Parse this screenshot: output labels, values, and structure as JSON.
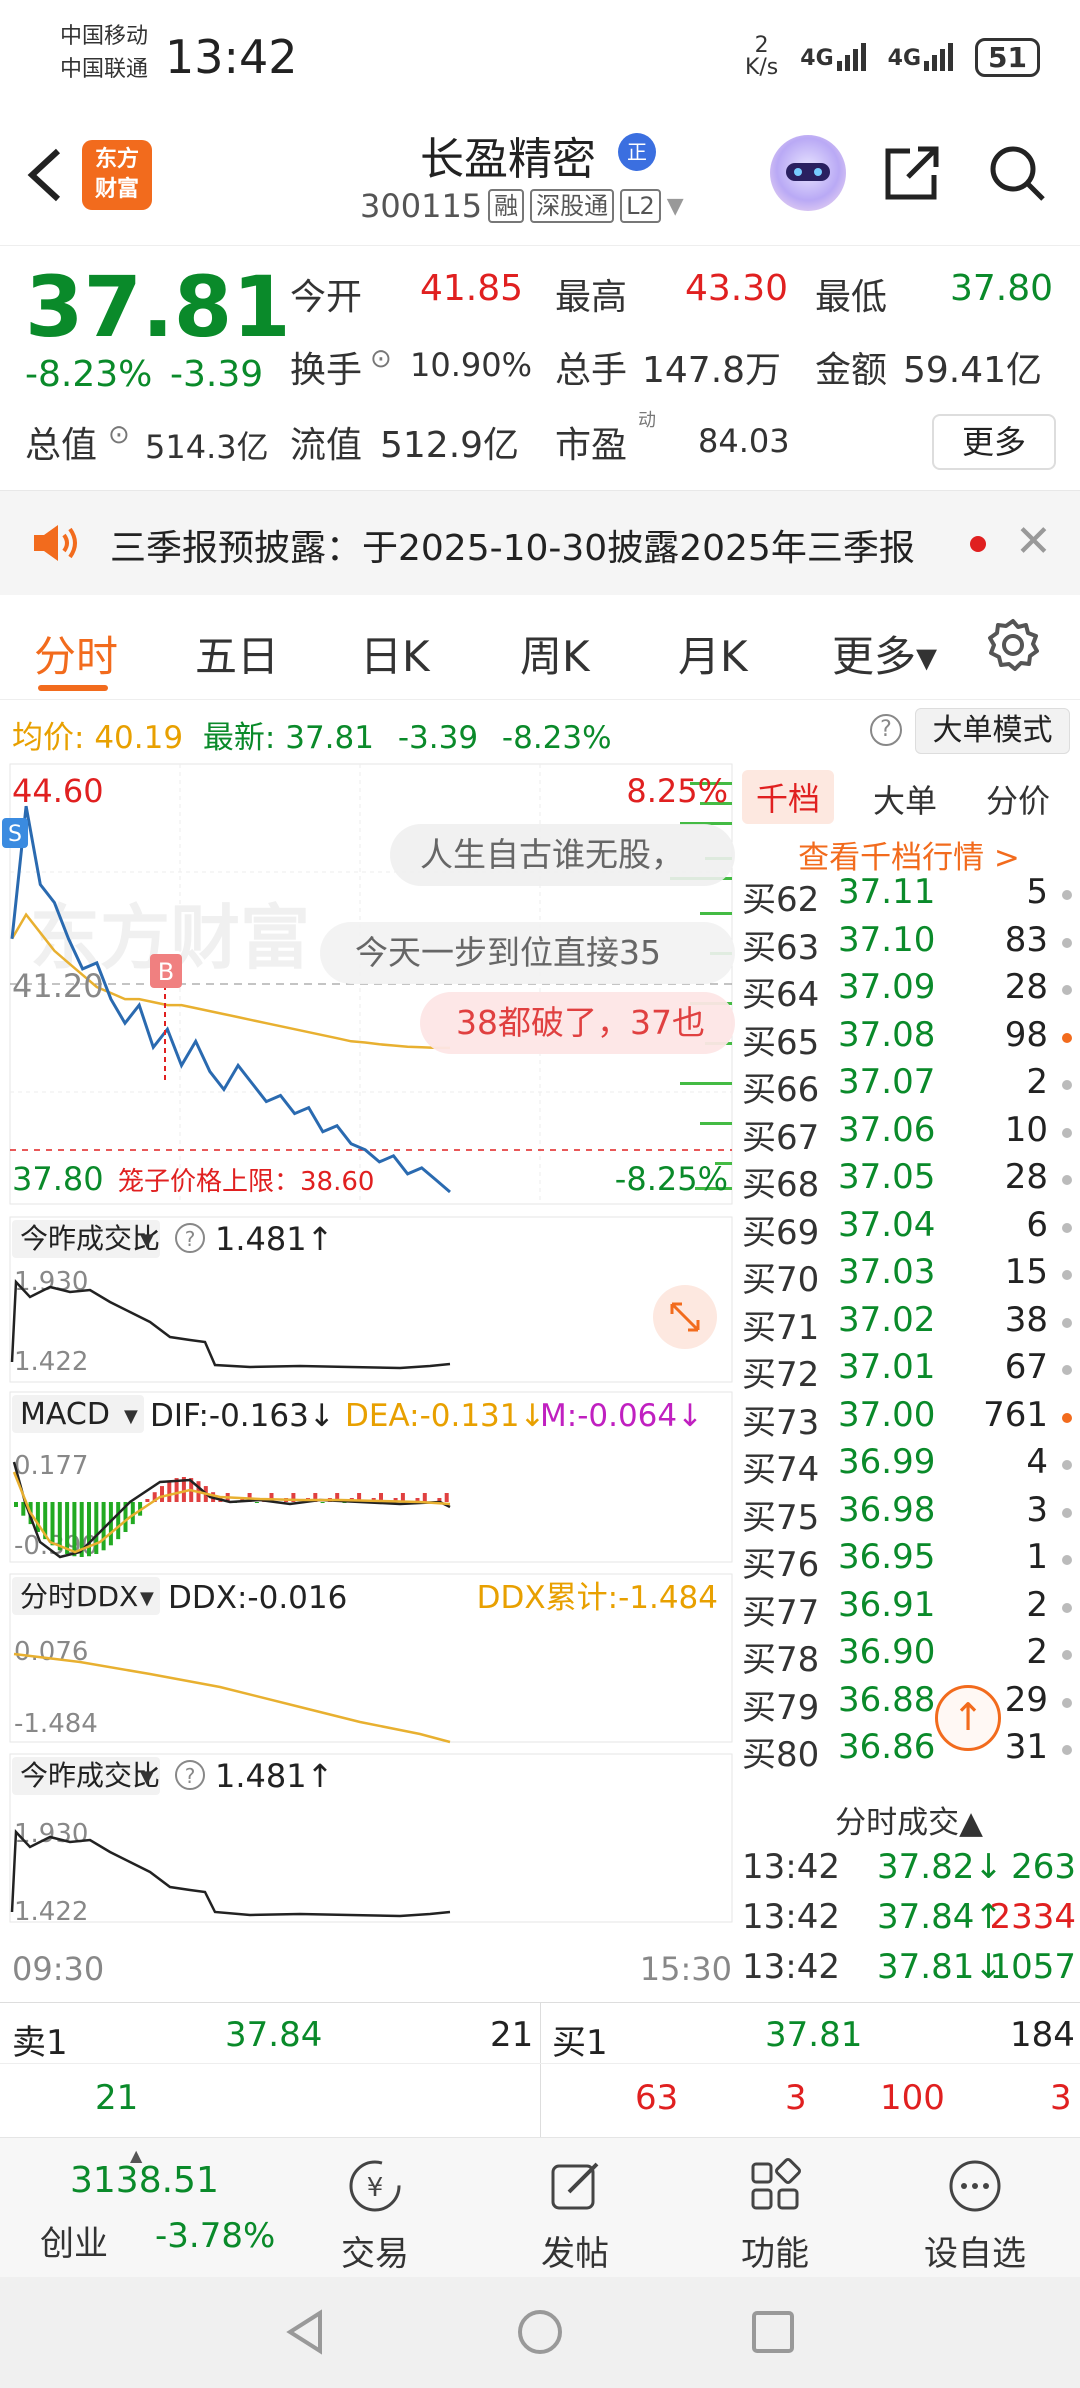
{
  "status_bar": {
    "carrier1": "中国移动",
    "carrier2": "中国联通",
    "time": "13:42",
    "net_speed": "2",
    "net_unit": "K/s",
    "signal1": "4G",
    "signal2": "4G",
    "battery": "51"
  },
  "header": {
    "logo_line1": "东方",
    "logo_line2": "财富",
    "stock_name": "长盈精密",
    "zheng_badge": "正",
    "stock_code": "300115",
    "tag1": "融",
    "tag2": "深股通",
    "tag3": "L2"
  },
  "quote": {
    "price": "37.81",
    "change_pct": "-8.23%",
    "change_amt": "-3.39",
    "open_label": "今开",
    "open": "41.85",
    "high_label": "最高",
    "high": "43.30",
    "low_label": "最低",
    "low": "37.80",
    "turnover_label": "换手",
    "turnover": "10.90%",
    "volume_label": "总手",
    "volume": "147.8万",
    "amount_label": "金额",
    "amount": "59.41亿",
    "mktcap_label": "总值",
    "mktcap": "514.3亿",
    "float_label": "流值",
    "float": "512.9亿",
    "pe_label": "市盈",
    "pe_sup": "动",
    "pe": "84.03",
    "more": "更多"
  },
  "notice": {
    "text": "三季报预披露：于2025-10-30披露2025年三季报"
  },
  "tabs": [
    "分时",
    "五日",
    "日K",
    "周K",
    "月K",
    "更多▾"
  ],
  "info_row": {
    "avg_label": "均价:",
    "avg": "40.19",
    "latest_label": "最新:",
    "latest": "37.81",
    "latest_chg": "-3.39",
    "latest_pct": "-8.23%",
    "help": "?",
    "mode": "大单模式"
  },
  "chart": {
    "price_high": "44.60",
    "price_mid": "41.20",
    "price_low": "37.80",
    "pct_high": "8.25%",
    "pct_low": "-8.25%",
    "watermark": "东方财富",
    "limit_label": "笼子价格上限：38.60",
    "marker_s": "S",
    "marker_b": "B",
    "danmaku1": "人生自古谁无股，",
    "danmaku2": "今天一步到位直接35",
    "danmaku3": "38都破了，37也",
    "vol_ratio_label": "今昨成交比",
    "vol_ratio": "1.481↑",
    "vol_top": "1.930",
    "vol_bottom": "1.422",
    "macd_label": "MACD",
    "dif": "DIF:-0.163↓",
    "dea": "DEA:-0.131↓",
    "m": "M:-0.064↓",
    "macd_top": "0.177",
    "macd_bottom": "-0.390",
    "ddx_label": "分时DDX",
    "ddx": "DDX:-0.016",
    "ddx_cum": "DDX累计:-1.484",
    "ddx_top": "0.076",
    "ddx_bottom": "-1.484",
    "vol_ratio2_label": "今昨成交比",
    "vol_ratio2": "1.481↑",
    "vol2_top": "1.930",
    "vol2_bottom": "1.422",
    "time_start": "09:30",
    "time_end": "15:30"
  },
  "chart_data": {
    "type": "line",
    "series": [
      {
        "name": "price",
        "values": [
          42.0,
          44.2,
          42.9,
          42.6,
          42.0,
          41.5,
          41.6,
          41.0,
          40.6,
          40.9,
          40.2,
          40.5,
          39.9,
          40.3,
          39.8,
          39.5,
          39.9,
          39.6,
          39.3,
          39.4,
          39.1,
          39.2,
          38.8,
          38.9,
          38.6,
          38.5,
          38.3,
          38.4,
          38.1,
          38.2,
          38.0,
          37.8
        ]
      },
      {
        "name": "avg",
        "values": [
          42.0,
          42.4,
          42.1,
          41.8,
          41.6,
          41.4,
          41.2,
          41.1,
          41.0,
          41.0,
          40.95,
          40.9,
          40.9,
          40.85,
          40.8,
          40.75,
          40.7,
          40.65,
          40.6,
          40.55,
          40.5,
          40.45,
          40.4,
          40.35,
          40.3,
          40.28,
          40.25,
          40.23,
          40.21,
          40.2,
          40.19,
          40.19
        ]
      }
    ],
    "ylim": [
      37.8,
      44.6
    ]
  },
  "orderbook": {
    "tabs": [
      "千档",
      "大单",
      "分价"
    ],
    "link": "查看千档行情 >",
    "rows": [
      {
        "label": "买62",
        "price": "37.11",
        "vol": "5",
        "hl": false
      },
      {
        "label": "买63",
        "price": "37.10",
        "vol": "83",
        "hl": false
      },
      {
        "label": "买64",
        "price": "37.09",
        "vol": "28",
        "hl": false
      },
      {
        "label": "买65",
        "price": "37.08",
        "vol": "98",
        "hl": true
      },
      {
        "label": "买66",
        "price": "37.07",
        "vol": "2",
        "hl": false
      },
      {
        "label": "买67",
        "price": "37.06",
        "vol": "10",
        "hl": false
      },
      {
        "label": "买68",
        "price": "37.05",
        "vol": "28",
        "hl": false
      },
      {
        "label": "买69",
        "price": "37.04",
        "vol": "6",
        "hl": false
      },
      {
        "label": "买70",
        "price": "37.03",
        "vol": "15",
        "hl": false
      },
      {
        "label": "买71",
        "price": "37.02",
        "vol": "38",
        "hl": false
      },
      {
        "label": "买72",
        "price": "37.01",
        "vol": "67",
        "hl": false
      },
      {
        "label": "买73",
        "price": "37.00",
        "vol": "761",
        "hl": true
      },
      {
        "label": "买74",
        "price": "36.99",
        "vol": "4",
        "hl": false
      },
      {
        "label": "买75",
        "price": "36.98",
        "vol": "3",
        "hl": false
      },
      {
        "label": "买76",
        "price": "36.95",
        "vol": "1",
        "hl": false
      },
      {
        "label": "买77",
        "price": "36.91",
        "vol": "2",
        "hl": false
      },
      {
        "label": "买78",
        "price": "36.90",
        "vol": "2",
        "hl": false
      },
      {
        "label": "买79",
        "price": "36.88",
        "vol": "29",
        "hl": false
      },
      {
        "label": "买80",
        "price": "36.86",
        "vol": "31",
        "hl": false
      }
    ],
    "trades_title": "分时成交▲",
    "trades": [
      {
        "time": "13:42",
        "price": "37.82↓",
        "vol": "263",
        "color": "green"
      },
      {
        "time": "13:42",
        "price": "37.84↑",
        "vol": "2334",
        "color": "red"
      },
      {
        "time": "13:42",
        "price": "37.81↓",
        "vol": "1057",
        "color": "green"
      }
    ],
    "top_btn": "↑"
  },
  "book1": {
    "sell_label": "卖1",
    "sell_price": "37.84",
    "sell_vol": "21",
    "buy_label": "买1",
    "buy_price": "37.81",
    "buy_vol": "184",
    "sell_queue": [
      "21"
    ],
    "buy_queue": [
      "63",
      "3",
      "100",
      "3"
    ]
  },
  "bottom_nav": {
    "index_value": "3138.51",
    "index_name": "创业",
    "index_pct": "-3.78%",
    "items": [
      "交易",
      "发帖",
      "功能",
      "设自选"
    ]
  }
}
